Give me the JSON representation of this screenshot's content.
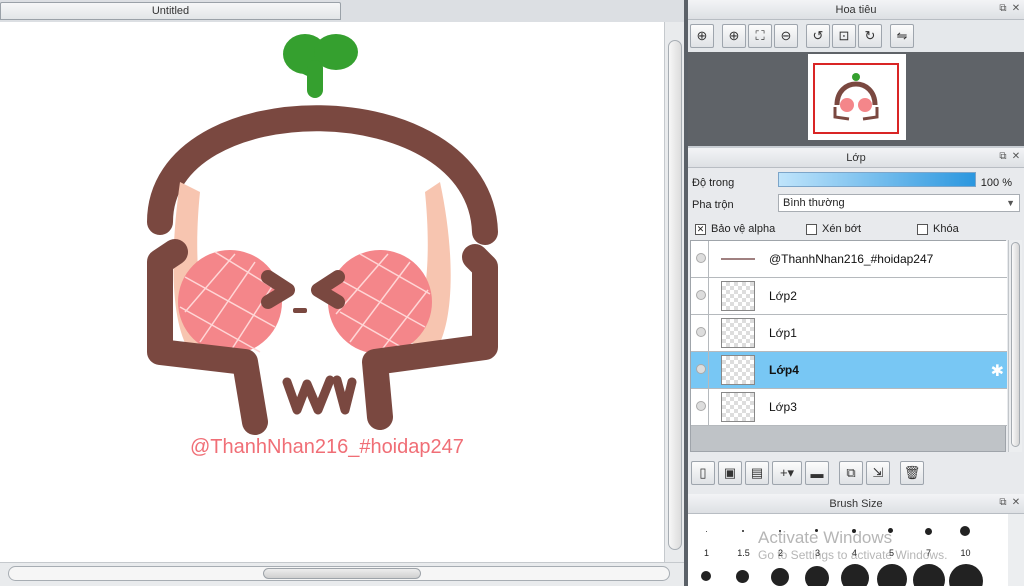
{
  "document": {
    "tab_title": "Untitled",
    "credit_text": "@ThanhNhan216_#hoidap247"
  },
  "navigator": {
    "title": "Hoa tiêu",
    "tools": [
      "zoom-fit-icon",
      "zoom-in-icon",
      "fit-icon",
      "zoom-out-icon",
      "rotate-left-icon",
      "fit-frame-icon",
      "rotate-right-icon",
      "flip-icon"
    ]
  },
  "layers": {
    "title": "Lớp",
    "opacity_label": "Độ trong",
    "opacity_value": "100 %",
    "opacity": 1.0,
    "blend_label": "Pha trộn",
    "blend_value": "Bình thường",
    "protect_alpha": "Bảo vệ alpha",
    "clipping": "Xén bớt",
    "lock": "Khóa",
    "items": [
      {
        "name": "@ThanhNhan216_#hoidap247",
        "active": false
      },
      {
        "name": "Lớp2",
        "active": false
      },
      {
        "name": "Lớp1",
        "active": false
      },
      {
        "name": "Lớp4",
        "active": true
      },
      {
        "name": "Lớp3",
        "active": false
      }
    ]
  },
  "brush": {
    "title": "Brush Size",
    "sizes": [
      "1",
      "1.5",
      "2",
      "3",
      "4",
      "5",
      "7",
      "10"
    ]
  },
  "watermark": {
    "title": "Activate Windows",
    "subtitle": "Go to Settings to activate Windows."
  }
}
